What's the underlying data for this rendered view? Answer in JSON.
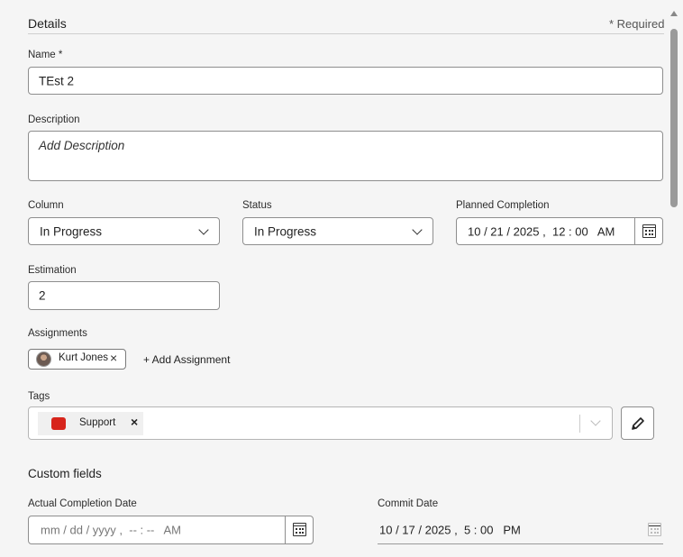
{
  "details": {
    "title": "Details",
    "required_note": "* Required"
  },
  "name": {
    "label": "Name",
    "required_mark": "*",
    "value": "TEst 2"
  },
  "description": {
    "label": "Description",
    "placeholder": "Add Description"
  },
  "column": {
    "label": "Column",
    "value": "In Progress"
  },
  "status": {
    "label": "Status",
    "value": "In Progress"
  },
  "planned": {
    "label": "Planned Completion",
    "value": "10 / 21 / 2025 ,  12 : 00   AM"
  },
  "estimation": {
    "label": "Estimation",
    "value": "2"
  },
  "assignments": {
    "label": "Assignments",
    "chip_name": "Kurt Jones",
    "remove": "×",
    "add_label": "+ Add Assignment"
  },
  "tags": {
    "label": "Tags",
    "tag_name": "Support",
    "tag_color": "#d7251c",
    "remove": "×"
  },
  "custom_fields": {
    "title": "Custom fields"
  },
  "actual_completion": {
    "label": "Actual Completion Date",
    "placeholder": "mm / dd / yyyy ,  -- : --   AM"
  },
  "commit_date": {
    "label": "Commit Date",
    "value": "10 / 17 / 2025 ,  5 : 00   PM"
  },
  "icons": {
    "calendar": "calendar-icon",
    "chevron": "chevron-down-icon",
    "pencil": "pencil-icon",
    "close": "close-icon"
  }
}
